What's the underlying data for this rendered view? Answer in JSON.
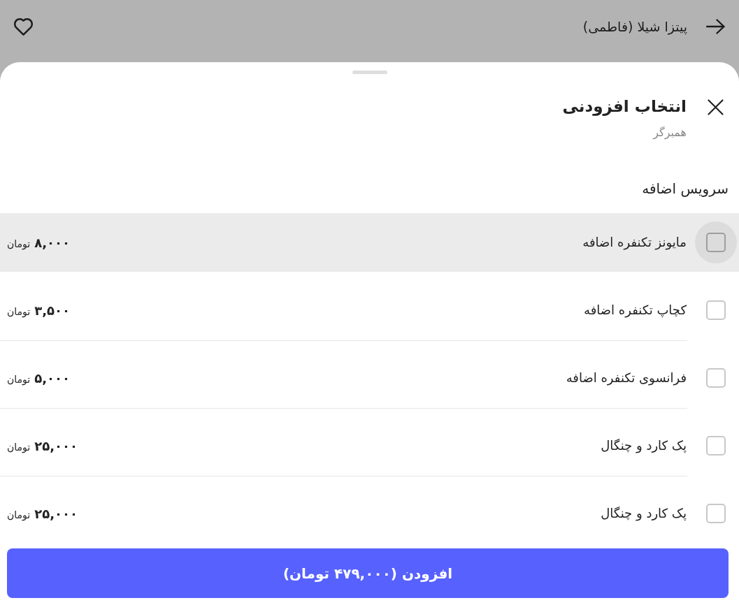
{
  "top_bar": {
    "title": "پیتزا شیلا (فاطمی)",
    "favorited": false
  },
  "sheet": {
    "title": "انتخاب افزودنی",
    "subtitle": "همبرگر"
  },
  "section": {
    "title": "سرویس اضافه",
    "options": [
      {
        "label": "مایونز تکنفره اضافه",
        "price": "۸,۰۰۰",
        "currency": "تومان",
        "checked": false,
        "highlighted": true
      },
      {
        "label": "کچاپ تکنفره اضافه",
        "price": "۳,۵۰۰",
        "currency": "تومان",
        "checked": false,
        "highlighted": false
      },
      {
        "label": "فرانسوی تکنفره اضافه",
        "price": "۵,۰۰۰",
        "currency": "تومان",
        "checked": false,
        "highlighted": false
      },
      {
        "label": "پک کارد و چنگال",
        "price": "۲۵,۰۰۰",
        "currency": "تومان",
        "checked": false,
        "highlighted": false
      },
      {
        "label": "پک کارد و چنگال",
        "price": "۲۵,۰۰۰",
        "currency": "تومان",
        "checked": false,
        "highlighted": false
      }
    ]
  },
  "add_button": {
    "label": "افزودن (۴۷۹,۰۰۰ تومان)"
  }
}
